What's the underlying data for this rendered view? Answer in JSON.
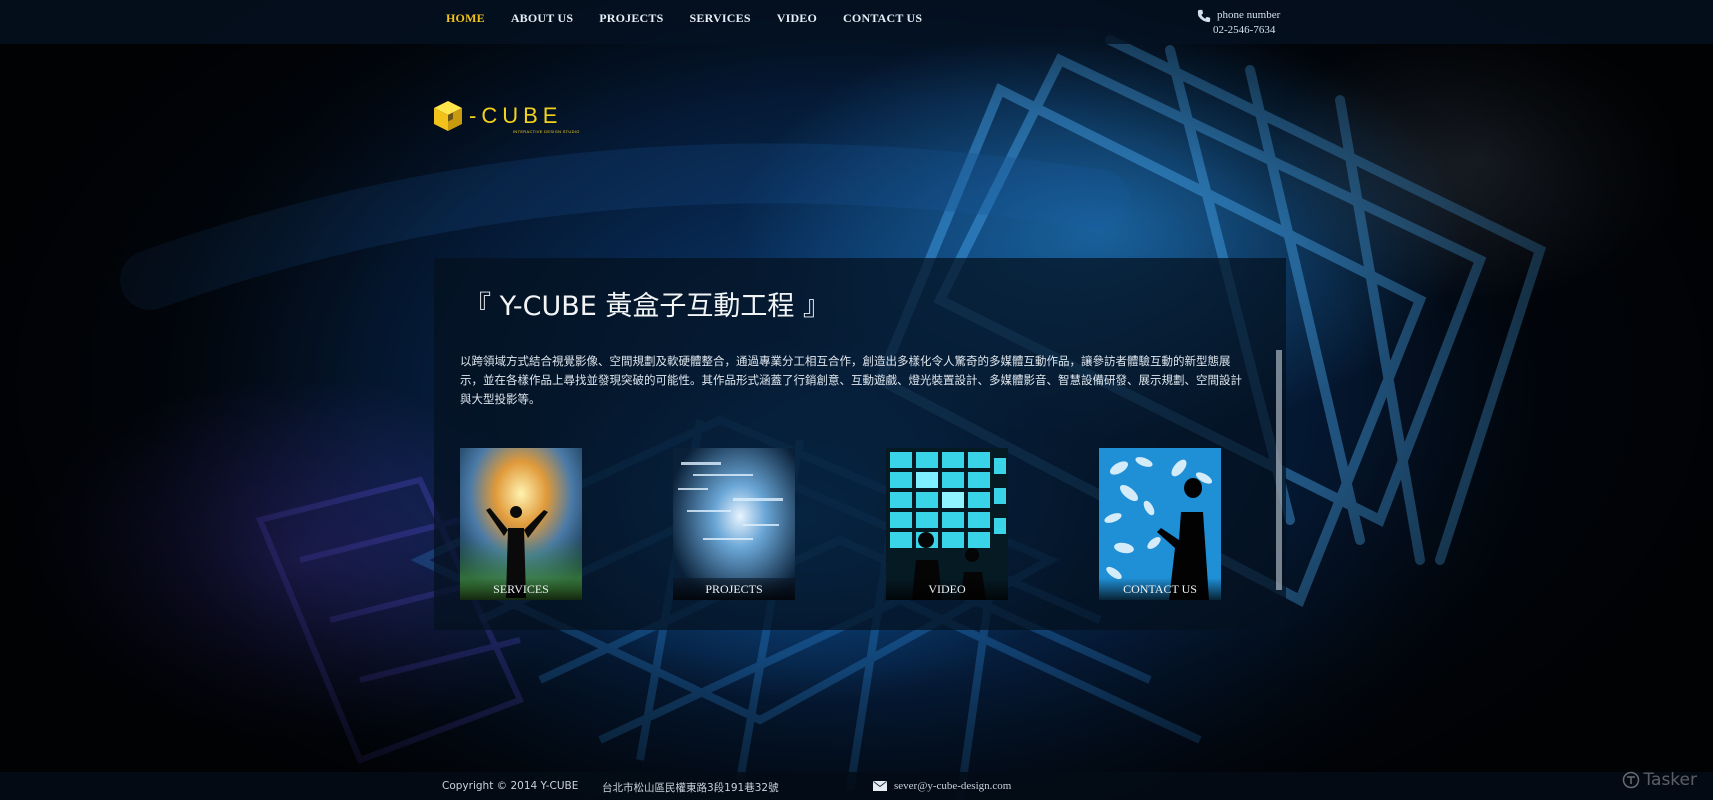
{
  "nav": {
    "items": [
      {
        "label": "HOME",
        "active": true
      },
      {
        "label": "ABOUT US",
        "active": false
      },
      {
        "label": "PROJECTS",
        "active": false
      },
      {
        "label": "SERVICES",
        "active": false
      },
      {
        "label": "VIDEO",
        "active": false
      },
      {
        "label": "CONTACT US",
        "active": false
      }
    ]
  },
  "header": {
    "phone_label": "phone number",
    "phone_number": "02-2546-7634",
    "phone_icon": "phone-icon"
  },
  "logo": {
    "text": "-CUBE",
    "subtitle": "INTERACTIVE DESIGN STUDIO",
    "icon": "cube-logo-icon"
  },
  "main": {
    "title": "『 Y-CUBE 黃盒子互動工程 』",
    "description": "以跨領域方式結合視覺影像、空間規劃及軟硬體整合，通過專業分工相互合作，創造出多樣化令人驚奇的多媒體互動作品，讓參訪者體驗互動的新型態展示，並在各樣作品上尋找並發現突破的可能性。其作品形式涵蓋了行銷創意、互動遊戲、燈光裝置設計、多媒體影音、智慧設備研發、展示規劃、空間設計與大型投影等。",
    "tiles": [
      {
        "label": "SERVICES"
      },
      {
        "label": "PROJECTS"
      },
      {
        "label": "VIDEO"
      },
      {
        "label": "CONTACT US"
      }
    ]
  },
  "footer": {
    "copyright": "Copyright © 2014 Y-CUBE",
    "address": "台北市松山區民權東路3段191巷32號",
    "email": "sever@y-cube-design.com",
    "email_icon": "mail-icon"
  },
  "watermark": {
    "text": "Tasker"
  },
  "colors": {
    "accent": "#f2c21b",
    "nav_text": "#e6eef6",
    "panel_bg": "#04101e"
  }
}
